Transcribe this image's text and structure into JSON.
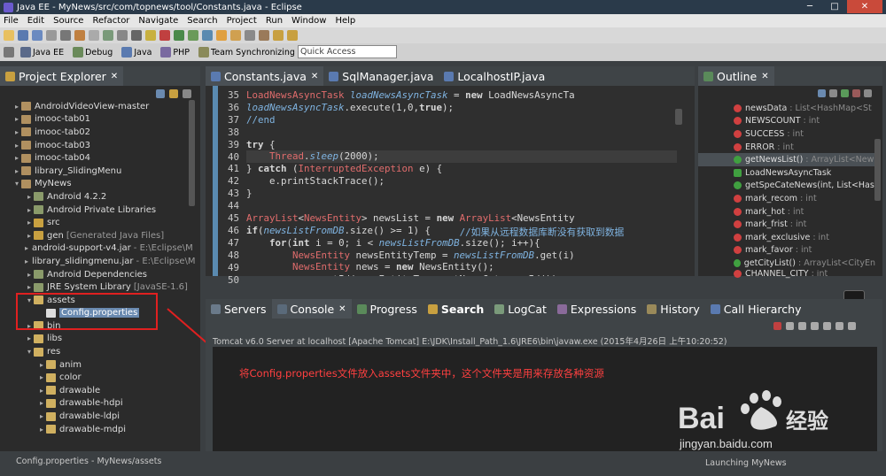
{
  "window": {
    "title": "Java EE - MyNews/src/com/topnews/tool/Constants.java - Eclipse"
  },
  "menu": [
    "File",
    "Edit",
    "Source",
    "Refactor",
    "Navigate",
    "Search",
    "Project",
    "Run",
    "Window",
    "Help"
  ],
  "perspectives": [
    "Java EE",
    "Debug",
    "Java",
    "PHP",
    "Team Synchronizing"
  ],
  "quick_access": {
    "placeholder": "Quick Access"
  },
  "explorer": {
    "title": "Project Explorer",
    "items": [
      {
        "label": "AndroidVideoView-master",
        "suffix": ""
      },
      {
        "label": "imooc-tab01",
        "suffix": ""
      },
      {
        "label": "imooc-tab02",
        "suffix": ""
      },
      {
        "label": "imooc-tab03",
        "suffix": ""
      },
      {
        "label": "imooc-tab04",
        "suffix": ""
      },
      {
        "label": "library_SlidingMenu",
        "suffix": ""
      },
      {
        "label": "MyNews",
        "suffix": ""
      },
      {
        "label": "Android 4.2.2",
        "suffix": ""
      },
      {
        "label": "Android Private Libraries",
        "suffix": ""
      },
      {
        "label": "src",
        "suffix": ""
      },
      {
        "label": "gen",
        "suffix": "[Generated Java Files]"
      },
      {
        "label": "android-support-v4.jar",
        "suffix": "- E:\\Eclipse\\M"
      },
      {
        "label": "library_slidingmenu.jar",
        "suffix": "- E:\\Eclipse\\M"
      },
      {
        "label": "Android Dependencies",
        "suffix": ""
      },
      {
        "label": "JRE System Library",
        "suffix": "[JavaSE-1.6]"
      },
      {
        "label": "assets",
        "suffix": ""
      },
      {
        "label": "Config.properties",
        "suffix": ""
      },
      {
        "label": "bin",
        "suffix": ""
      },
      {
        "label": "libs",
        "suffix": ""
      },
      {
        "label": "res",
        "suffix": ""
      },
      {
        "label": "anim",
        "suffix": ""
      },
      {
        "label": "color",
        "suffix": ""
      },
      {
        "label": "drawable",
        "suffix": ""
      },
      {
        "label": "drawable-hdpi",
        "suffix": ""
      },
      {
        "label": "drawable-ldpi",
        "suffix": ""
      },
      {
        "label": "drawable-mdpi",
        "suffix": ""
      }
    ]
  },
  "editor": {
    "tabs": [
      "Constants.java",
      "SqlManager.java",
      "LocalhostIP.java"
    ],
    "line_numbers": [
      "35",
      "36",
      "37",
      "38",
      "39",
      "40",
      "41",
      "42",
      "43",
      "44",
      "45",
      "46",
      "47",
      "48",
      "49",
      "50"
    ]
  },
  "outline": {
    "title": "Outline",
    "items": [
      {
        "name": "newsData",
        "type": ": List<HashMap<St"
      },
      {
        "name": "NEWSCOUNT",
        "type": ": int"
      },
      {
        "name": "SUCCESS",
        "type": ": int"
      },
      {
        "name": "ERROR",
        "type": ": int"
      },
      {
        "name": "getNewsList()",
        "type": ": ArrayList<New"
      },
      {
        "name": "LoadNewsAsyncTask",
        "type": ""
      },
      {
        "name": "getSpeCateNews(int, List<Has",
        "type": ""
      },
      {
        "name": "mark_recom",
        "type": ": int"
      },
      {
        "name": "mark_hot",
        "type": ": int"
      },
      {
        "name": "mark_frist",
        "type": ": int"
      },
      {
        "name": "mark_exclusive",
        "type": ": int"
      },
      {
        "name": "mark_favor",
        "type": ": int"
      },
      {
        "name": "getCityList()",
        "type": ": ArrayList<CityEn"
      },
      {
        "name": "CHANNEL_CITY",
        "type": ": int"
      }
    ]
  },
  "console": {
    "tabs": [
      "Servers",
      "Console",
      "Progress",
      "Search",
      "LogCat",
      "Expressions",
      "History",
      "Call Hierarchy"
    ],
    "title": "Tomcat v6.0 Server at localhost [Apache Tomcat] E:\\JDK\\Install_Path_1.6\\JRE6\\bin\\javaw.exe (2015年4月26日 上午10:20:52)",
    "annotation": "将Config.properties文件放入assets文件夹中，这个文件夹是用来存放各种资源"
  },
  "status": {
    "left": "Config.properties - MyNews/assets",
    "right": "Launching MyNews"
  },
  "watermark": {
    "brand": "Bai",
    "brand_cn": "经验",
    "url": "jingyan.baidu.com"
  },
  "colors": {
    "accent_red": "#e02020",
    "selection_blue": "#5a8ab0"
  }
}
